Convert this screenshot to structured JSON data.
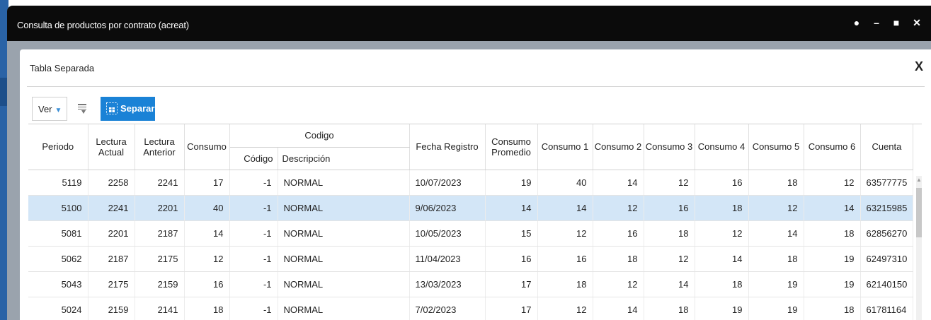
{
  "window": {
    "title": "Consulta de productos por contrato (acreat)"
  },
  "dialog": {
    "title": "Tabla Separada",
    "close_label": "X"
  },
  "toolbar": {
    "ver_label": "Ver",
    "separar_label": "Separar"
  },
  "table": {
    "headers": {
      "periodo": "Periodo",
      "lectura_actual": "Lectura Actual",
      "lectura_anterior": "Lectura Anterior",
      "consumo": "Consumo",
      "codigo_group": "Codigo",
      "codigo": "Código",
      "descripcion": "Descripción",
      "fecha_registro": "Fecha Registro",
      "consumo_promedio": "Consumo Promedio",
      "consumo1": "Consumo 1",
      "consumo2": "Consumo 2",
      "consumo3": "Consumo 3",
      "consumo4": "Consumo 4",
      "consumo5": "Consumo 5",
      "consumo6": "Consumo 6",
      "cuenta": "Cuenta"
    },
    "rows": [
      {
        "periodo": "5119",
        "lectura_actual": "2258",
        "lectura_anterior": "2241",
        "consumo": "17",
        "codigo": "-1",
        "descripcion": "NORMAL",
        "fecha_registro": "10/07/2023",
        "consumo_promedio": "19",
        "c1": "40",
        "c2": "14",
        "c3": "12",
        "c4": "16",
        "c5": "18",
        "c6": "12",
        "cuenta": "63577775"
      },
      {
        "periodo": "5100",
        "lectura_actual": "2241",
        "lectura_anterior": "2201",
        "consumo": "40",
        "codigo": "-1",
        "descripcion": "NORMAL",
        "fecha_registro": "9/06/2023",
        "consumo_promedio": "14",
        "c1": "14",
        "c2": "12",
        "c3": "16",
        "c4": "18",
        "c5": "12",
        "c6": "14",
        "cuenta": "63215985"
      },
      {
        "periodo": "5081",
        "lectura_actual": "2201",
        "lectura_anterior": "2187",
        "consumo": "14",
        "codigo": "-1",
        "descripcion": "NORMAL",
        "fecha_registro": "10/05/2023",
        "consumo_promedio": "15",
        "c1": "12",
        "c2": "16",
        "c3": "18",
        "c4": "12",
        "c5": "14",
        "c6": "18",
        "cuenta": "62856270"
      },
      {
        "periodo": "5062",
        "lectura_actual": "2187",
        "lectura_anterior": "2175",
        "consumo": "12",
        "codigo": "-1",
        "descripcion": "NORMAL",
        "fecha_registro": "11/04/2023",
        "consumo_promedio": "16",
        "c1": "16",
        "c2": "18",
        "c3": "12",
        "c4": "14",
        "c5": "18",
        "c6": "19",
        "cuenta": "62497310"
      },
      {
        "periodo": "5043",
        "lectura_actual": "2175",
        "lectura_anterior": "2159",
        "consumo": "16",
        "codigo": "-1",
        "descripcion": "NORMAL",
        "fecha_registro": "13/03/2023",
        "consumo_promedio": "17",
        "c1": "18",
        "c2": "12",
        "c3": "14",
        "c4": "18",
        "c5": "19",
        "c6": "19",
        "cuenta": "62140150"
      },
      {
        "periodo": "5024",
        "lectura_actual": "2159",
        "lectura_anterior": "2141",
        "consumo": "18",
        "codigo": "-1",
        "descripcion": "NORMAL",
        "fecha_registro": "7/02/2023",
        "consumo_promedio": "17",
        "c1": "12",
        "c2": "14",
        "c3": "18",
        "c4": "19",
        "c5": "19",
        "c6": "18",
        "cuenta": "61781164"
      }
    ],
    "selected_row_index": 1
  },
  "colors": {
    "titlebar": "#0b0b0b",
    "accent": "#1a82d6",
    "selected_row": "#d3e6f7",
    "overlay": "#9aa3ad"
  }
}
